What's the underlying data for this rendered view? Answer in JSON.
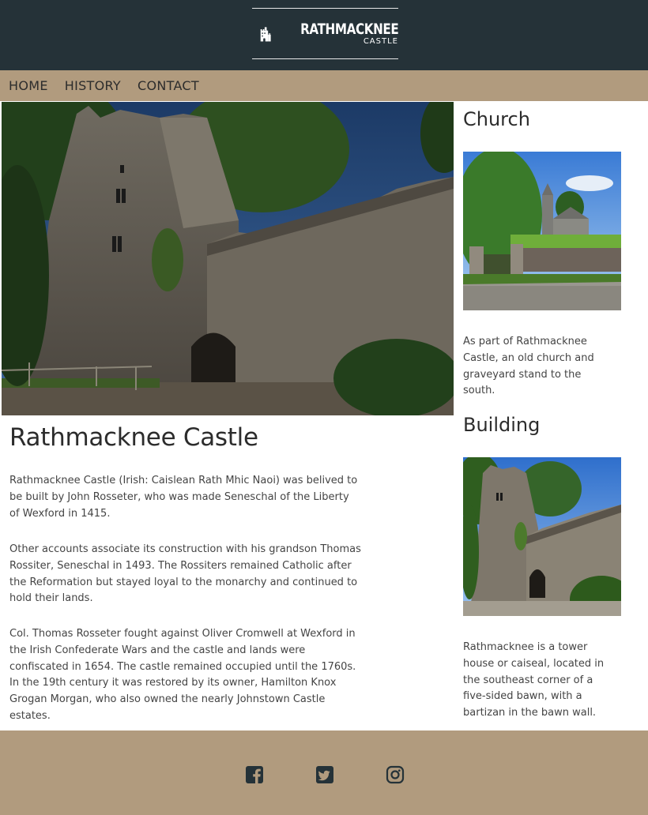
{
  "header": {
    "logo_name": "RATHMACKNEE",
    "logo_sub": "CASTLE"
  },
  "nav": {
    "items": [
      {
        "label": "HOME"
      },
      {
        "label": "HISTORY"
      },
      {
        "label": "CONTACT"
      }
    ]
  },
  "main": {
    "title": "Rathmacknee Castle",
    "paragraphs": [
      "Rathmacknee Castle (Irish: Caislean Rath Mhic Naoi) was belived to be built by John Rosseter, who was made Seneschal of the Liberty of Wexford in 1415.",
      "Other accounts associate its construction with his grandson Thomas Rossiter, Seneschal in 1493. The Rossiters remained Catholic after the Reformation but stayed loyal to the monarchy and continued to hold their lands.",
      "Col. Thomas Rosseter fought against Oliver Cromwell at Wexford in the Irish Confederate Wars and the castle and lands were confiscated in 1654. The castle remained occupied until the 1760s. In the 19th century it was restored by its owner, Hamilton Knox Grogan Morgan, who also owned the nearly Johnstown Castle estates."
    ]
  },
  "sidebar": {
    "sections": [
      {
        "heading": "Church",
        "text": "As part of Rathmacknee Castle, an old church and graveyard stand to the south."
      },
      {
        "heading": "Building",
        "text": "Rathmacknee is a tower house or caiseal, located in the southeast corner of a five-sided bawn, with a bartizan in the bawn wall."
      }
    ]
  },
  "footer": {
    "icons": [
      "facebook-icon",
      "twitter-icon",
      "instagram-icon"
    ]
  },
  "colors": {
    "header_bg": "#253238",
    "nav_bg": "#b19b7e",
    "footer_bg": "#b19b7e",
    "social_icon": "#253238"
  }
}
